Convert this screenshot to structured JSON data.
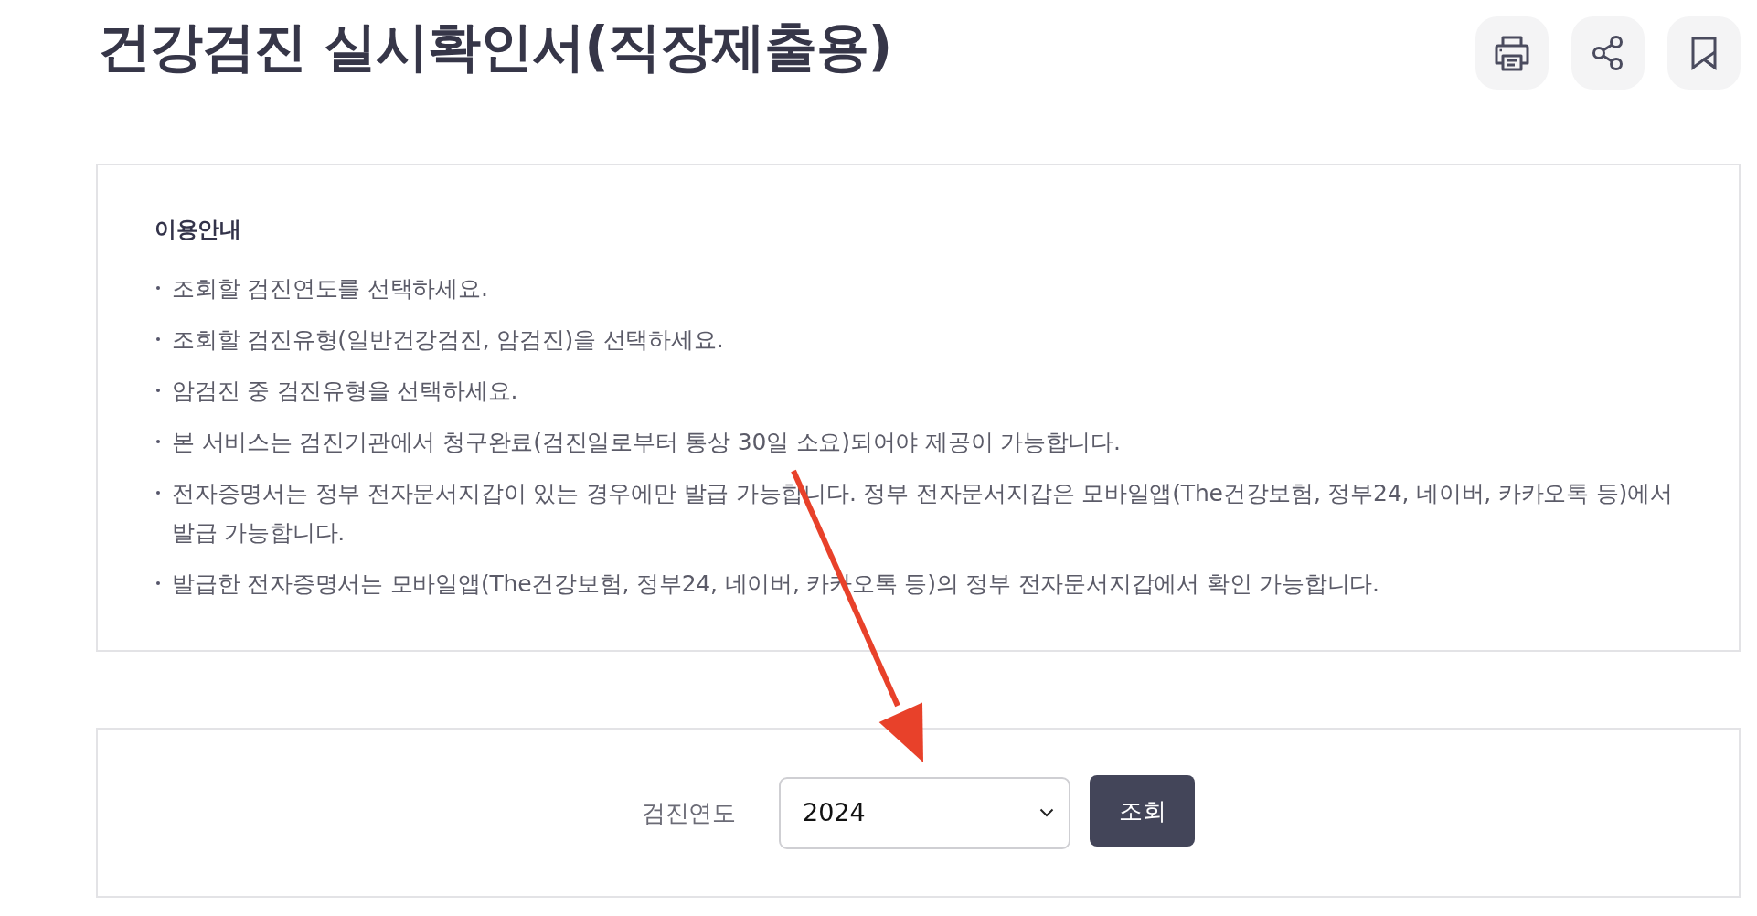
{
  "page": {
    "title": "건강검진 실시확인서(직장제출용)"
  },
  "guide": {
    "title": "이용안내",
    "items": [
      "조회할 검진연도를 선택하세요.",
      "조회할 검진유형(일반건강검진, 암검진)을 선택하세요.",
      "암검진 중 검진유형을 선택하세요.",
      "본 서비스는 검진기관에서 청구완료(검진일로부터 통상 30일 소요)되어야 제공이 가능합니다.",
      "전자증명서는 정부 전자문서지갑이 있는 경우에만 발급 가능합니다. 정부 전자문서지갑은 모바일앱(The건강보험, 정부24, 네이버, 카카오톡 등)에서 발급 가능합니다.",
      "발급한 전자증명서는 모바일앱(The건강보험, 정부24, 네이버, 카카오톡 등)의 정부 전자문서지갑에서 확인 가능합니다."
    ]
  },
  "search_form": {
    "label": "검진연도",
    "select": {
      "value": "2024"
    },
    "button": "조회"
  }
}
